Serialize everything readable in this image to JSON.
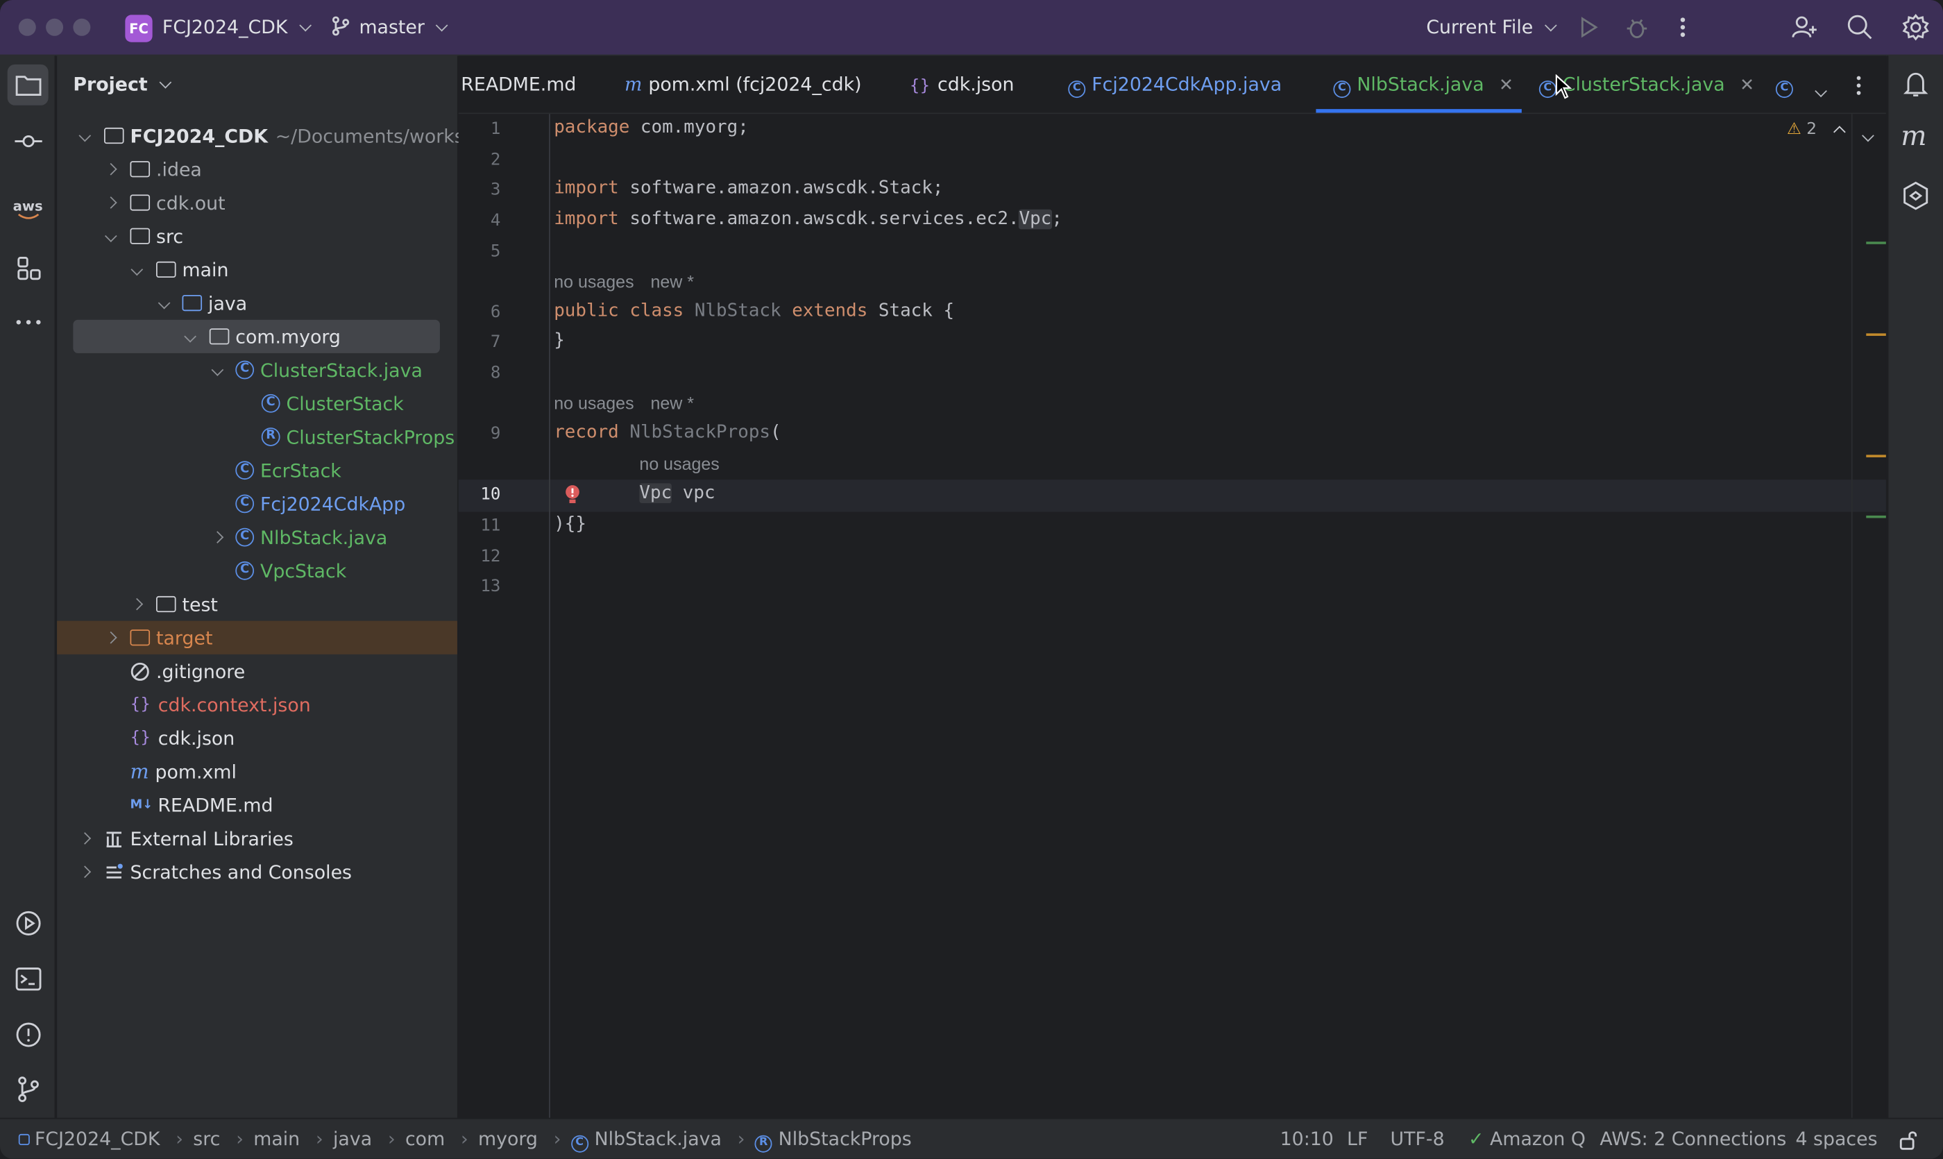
{
  "titlebar": {
    "project_badge": "FC",
    "project_name": "FCJ2024_CDK",
    "branch": "master",
    "run_config": "Current File"
  },
  "project_panel": {
    "title": "Project",
    "root_name": "FCJ2024_CDK",
    "root_path": "~/Documents/worksho",
    "items": [
      {
        "label": ".idea"
      },
      {
        "label": "cdk.out"
      },
      {
        "label": "src"
      },
      {
        "label": "main"
      },
      {
        "label": "java"
      },
      {
        "label": "com.myorg"
      },
      {
        "label": "ClusterStack.java"
      },
      {
        "label": "ClusterStack"
      },
      {
        "label": "ClusterStackProps"
      },
      {
        "label": "EcrStack"
      },
      {
        "label": "Fcj2024CdkApp"
      },
      {
        "label": "NlbStack.java"
      },
      {
        "label": "VpcStack"
      },
      {
        "label": "test"
      },
      {
        "label": "target"
      },
      {
        "label": ".gitignore"
      },
      {
        "label": "cdk.context.json"
      },
      {
        "label": "cdk.json"
      },
      {
        "label": "pom.xml"
      },
      {
        "label": "README.md"
      },
      {
        "label": "External Libraries"
      },
      {
        "label": "Scratches and Consoles"
      }
    ]
  },
  "tabs": [
    {
      "label": "README.md"
    },
    {
      "label": "pom.xml (fcj2024_cdk)"
    },
    {
      "label": "cdk.json"
    },
    {
      "label": "Fcj2024CdkApp.java"
    },
    {
      "label": "NlbStack.java"
    },
    {
      "label": "ClusterStack.java"
    }
  ],
  "editor": {
    "warning_count": "2",
    "line_numbers": [
      "1",
      "2",
      "3",
      "4",
      "5",
      "6",
      "7",
      "8",
      "9",
      "10",
      "11",
      "12",
      "13"
    ],
    "hints": {
      "no_usages": "no usages",
      "new": "new *"
    },
    "code": {
      "l1_kw": "package",
      "l1_rest": " com.myorg;",
      "l3_kw": "import",
      "l3_rest": " software.amazon.awscdk.Stack;",
      "l4_kw": "import",
      "l4_rest": " software.amazon.awscdk.services.ec2.",
      "l4_hl": "Vpc",
      "l4_end": ";",
      "l6_kw1": "public class",
      "l6_name": " NlbStack ",
      "l6_kw2": "extends",
      "l6_rest": " Stack {",
      "l7": "}",
      "l9_kw": "record",
      "l9_name": " NlbStackProps",
      "l9_rest": "(",
      "l10_type": "Vpc",
      "l10_rest": " vpc",
      "l11": "){}"
    }
  },
  "statusbar": {
    "crumbs": [
      "FCJ2024_CDK",
      "src",
      "main",
      "java",
      "com",
      "myorg",
      "NlbStack.java",
      "NlbStackProps"
    ],
    "position": "10:10",
    "line_sep": "LF",
    "encoding": "UTF-8",
    "amazon_q": "Amazon Q",
    "aws": "AWS: 2 Connections",
    "indent": "4 spaces"
  },
  "left_strip_icons": [
    "folder-icon",
    "commit-icon",
    "aws-icon",
    "structure-icon",
    "more-icon",
    "run-icon",
    "terminal-icon",
    "problems-icon",
    "git-icon"
  ],
  "aws_label": "aws",
  "colors": {
    "titlebar": "#3c2f56",
    "panel": "#2b2d30",
    "editor": "#1e1f22",
    "keyword": "#cf8e6d",
    "green_file": "#5fb865",
    "accent_blue": "#5c8fe6"
  }
}
